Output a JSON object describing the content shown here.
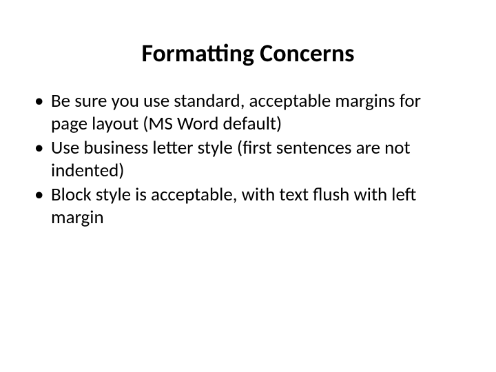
{
  "slide": {
    "title": "Formatting Concerns",
    "bullets": [
      "Be sure you use standard, acceptable margins for page layout (MS Word default)",
      "Use business letter style (first sentences are not indented)",
      "Block style is acceptable, with text flush with left margin"
    ]
  }
}
